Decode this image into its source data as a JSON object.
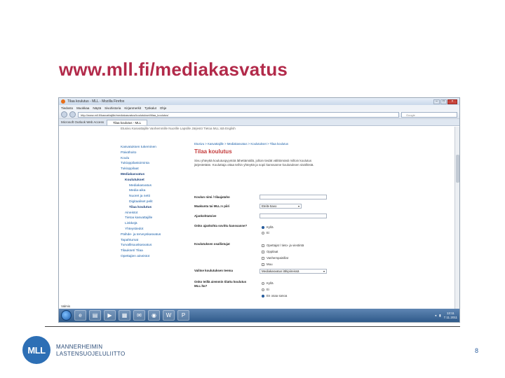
{
  "slide": {
    "title": "www.mll.fi/mediakasvatus",
    "page_number": "8",
    "org_logo_text": "MLL",
    "org_name_line1": "MANNERHEIMIN",
    "org_name_line2": "LASTENSUOJELULIITTO"
  },
  "browser": {
    "window_title": "Tilaa koulutus - MLL - Mozilla Firefox",
    "menu": [
      "Tiedosto",
      "Muokkaa",
      "Näytä",
      "Sivuhistoria",
      "Kirjanmerkit",
      "Työkalut",
      "Ohje"
    ],
    "url": "http://www.mll.fi/kasvattajille/mediakasvatus/koulutukset/tilaa_koulutus/",
    "search_placeholder": "Google",
    "bookmark": "Microsoft Outlook Web Access",
    "tab_label": "Tilaa koulutus - MLL",
    "status_text": "Valmis"
  },
  "page": {
    "topnav": "Etusivu  Kasvattajille  Vanhemmille  Nuorille  Lapsille  Järjestö  Tietoa MLL:stä  English",
    "sidebar": [
      {
        "label": "Kasvatuksen tukeminen",
        "level": 0,
        "bold": false
      },
      {
        "label": "Päivähoito",
        "level": 0,
        "bold": false
      },
      {
        "label": "Koulu",
        "level": 0,
        "bold": false
      },
      {
        "label": "Tukioppilastoiminta",
        "level": 0,
        "bold": false
      },
      {
        "label": "Tukioppilaat",
        "level": 0,
        "bold": false
      },
      {
        "label": "Mediakasvatus",
        "level": 0,
        "bold": true
      },
      {
        "label": "Koulutukset",
        "level": 1,
        "bold": true
      },
      {
        "label": "Mediakasvatus",
        "level": 2,
        "bold": false
      },
      {
        "label": "Media-aika",
        "level": 2,
        "bold": false
      },
      {
        "label": "Nuoret ja netti",
        "level": 2,
        "bold": false
      },
      {
        "label": "Digitaaliset pelit",
        "level": 2,
        "bold": false
      },
      {
        "label": "Tilaa koulutus",
        "level": 2,
        "bold": true
      },
      {
        "label": "Aineistot",
        "level": 1,
        "bold": false
      },
      {
        "label": "Tietoa kasvattajille",
        "level": 1,
        "bold": false
      },
      {
        "label": "Linkkejä",
        "level": 1,
        "bold": false
      },
      {
        "label": "Yhteystiedot",
        "level": 1,
        "bold": false
      },
      {
        "label": "Päihde- ja terveyskasvatus",
        "level": 0,
        "bold": false
      },
      {
        "label": "Tapahtumat",
        "level": 0,
        "bold": false
      },
      {
        "label": "Turvallisuuskasvatus",
        "level": 0,
        "bold": false
      },
      {
        "label": "Tilaukset/ Tilaa",
        "level": 0,
        "bold": false
      },
      {
        "label": "Opettajien aineistot",
        "level": 0,
        "bold": false
      }
    ],
    "breadcrumb": "Etusivu > Kasvattajille > Mediakasvatus > Koulutukset > Tilaa koulutus",
    "heading": "Tilaa koulutus",
    "intro": "Sivu yhteyttä koulutuspyyntöä lähettämällä, jolloin tiedät välittömästi milloin koulutus järjestetään. Kouluttaja ottaa teihin yhteyttä ja sopii kanssanne koulutuksen sisällöstä.",
    "form": {
      "organization_label": "Koulun nimi / tilaajataho",
      "region_label": "Maakunta tai MLL:n piiri",
      "region_value": "Etelä-Savo",
      "date_label": "Ajankohtatoive",
      "already_label": "Onko ajankohta sovittu kanssanne?",
      "already_options": [
        "Kyllä",
        "Ei"
      ],
      "audience_label": "Koulutuksen osallistujat",
      "audience_options": [
        "Opettajat / tieto- ja viestintä",
        "Oppilaat",
        "Vanhempainillat",
        "Muu"
      ],
      "topic_label": "Valitse koulutuksen teema",
      "topic_value": "Mediakasvatus lähipiireissä",
      "previous_label": "Onko teillä aiemmin tilattu koulutus MLL:lta?",
      "previous_options": [
        "Kyllä",
        "Ei",
        "En osaa sanoa"
      ]
    }
  },
  "taskbar": {
    "clock_time": "13:11",
    "clock_date": "7.11.2011"
  }
}
